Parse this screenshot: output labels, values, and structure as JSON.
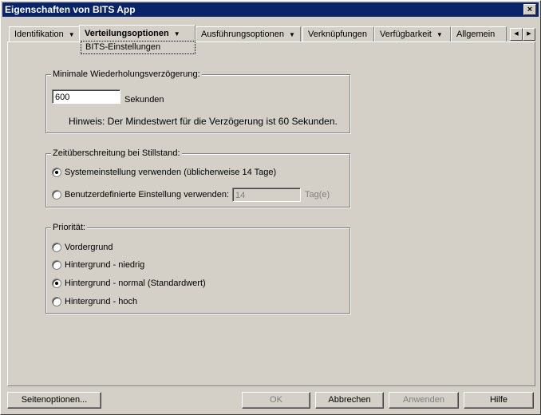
{
  "window": {
    "title": "Eigenschaften von BITS App",
    "close_label": "×"
  },
  "tabs": [
    {
      "label": "Identifikation",
      "has_menu": true
    },
    {
      "label": "Verteilungsoptionen",
      "has_menu": true,
      "active": true
    },
    {
      "label": "Ausführungsoptionen",
      "has_menu": true
    },
    {
      "label": "Verknüpfungen",
      "has_menu": false
    },
    {
      "label": "Verfügbarkeit",
      "has_menu": true
    },
    {
      "label": "Allgemein",
      "has_menu": false
    }
  ],
  "tab_scroll": {
    "left": "◀",
    "right": "▶"
  },
  "subtab": "BITS-Einstellungen",
  "retry_group": {
    "label": "Minimale Wiederholungsverzögerung:",
    "value": "600",
    "unit": "Sekunden",
    "hint": "Hinweis: Der Mindestwert für die Verzögerung ist 60 Sekunden."
  },
  "timeout_group": {
    "label": "Zeitüberschreitung bei Stillstand:",
    "option_system": "Systemeinstellung verwenden (üblicherweise 14 Tage)",
    "option_custom": "Benutzerdefinierte Einstellung verwenden:",
    "custom_value": "14",
    "custom_unit": "Tag(e)",
    "selected": "system"
  },
  "priority_group": {
    "label": "Priorität:",
    "options": [
      "Vordergrund",
      "Hintergrund - niedrig",
      "Hintergrund - normal (Standardwert)",
      "Hintergrund - hoch"
    ],
    "selected_index": 2
  },
  "buttons": {
    "page_options": "Seitenoptionen...",
    "ok": "OK",
    "cancel": "Abbrechen",
    "apply": "Anwenden",
    "help": "Hilfe"
  },
  "colors": {
    "titlebar": "#0a246a",
    "face": "#d4d0c8"
  }
}
